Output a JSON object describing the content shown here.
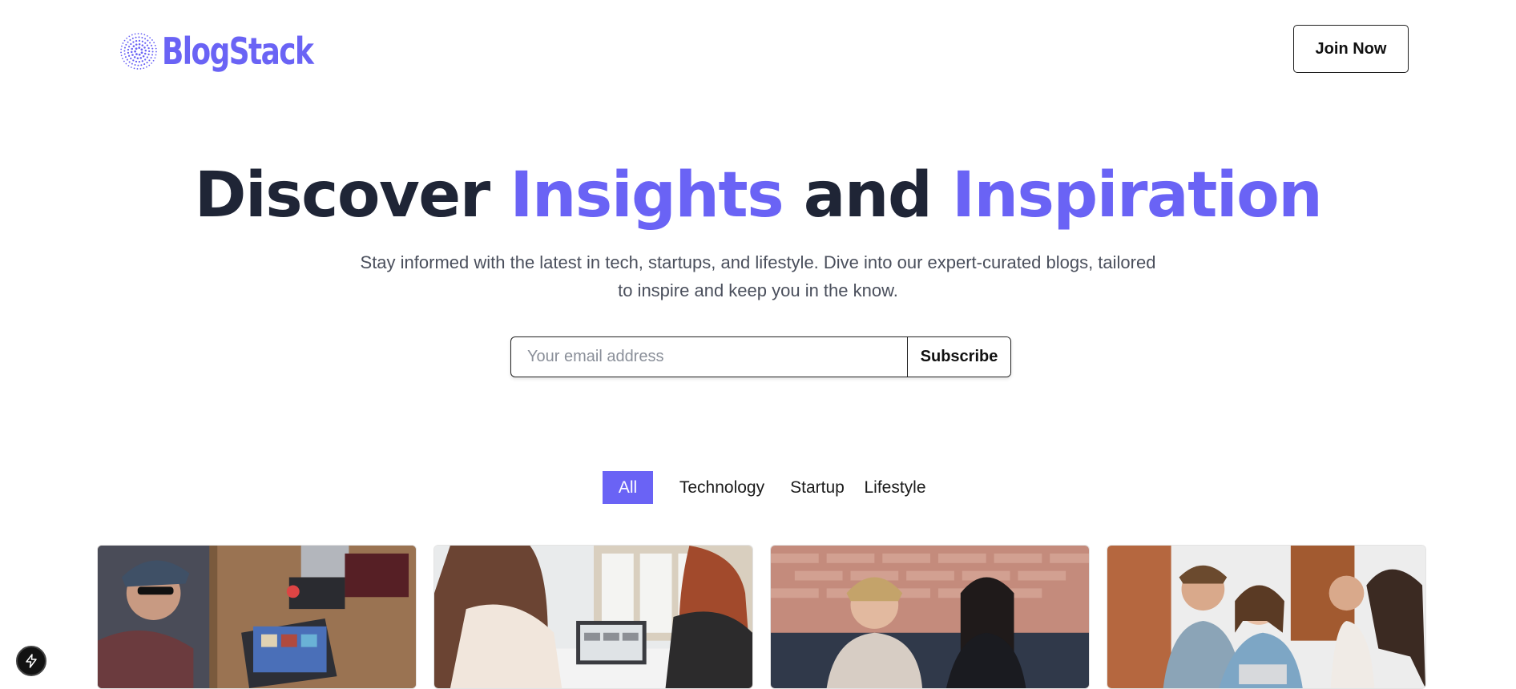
{
  "header": {
    "logo_text": "BlogStack",
    "join_label": "Join Now"
  },
  "hero": {
    "title_part1": "Discover ",
    "title_accent1": "Insights",
    "title_part2": " and ",
    "title_accent2": "Inspiration",
    "subtitle": "Stay informed with the latest in tech, startups, and lifestyle. Dive into our expert-curated blogs, tailored to inspire and keep you in the know."
  },
  "subscribe": {
    "placeholder": "Your email address",
    "button_label": "Subscribe"
  },
  "filters": [
    {
      "label": "All",
      "active": true
    },
    {
      "label": "Technology",
      "active": false
    },
    {
      "label": "Startup",
      "active": false
    },
    {
      "label": "Lifestyle",
      "active": false
    }
  ],
  "colors": {
    "accent": "#6a63f5",
    "heading": "#1f2536",
    "body_text": "#4a4f5c"
  },
  "icons": {
    "logo": "sunburst-dots-icon",
    "floating_action": "lightning-bolt-icon"
  }
}
